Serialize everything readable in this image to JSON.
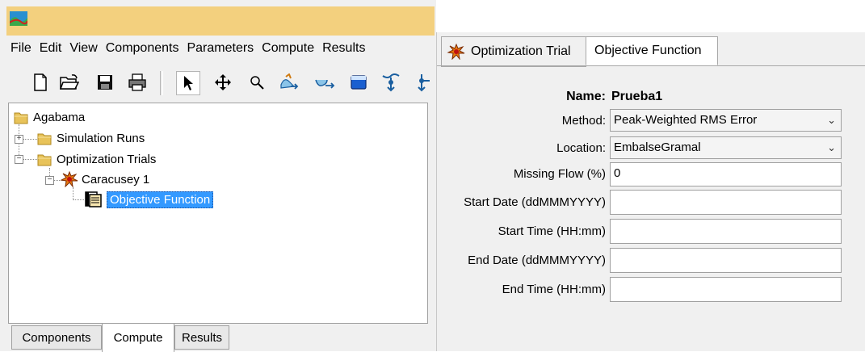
{
  "menu": {
    "items": [
      {
        "label": "File"
      },
      {
        "label": "Edit"
      },
      {
        "label": "View"
      },
      {
        "label": "Components"
      },
      {
        "label": "Parameters"
      },
      {
        "label": "Compute"
      },
      {
        "label": "Results"
      }
    ]
  },
  "toolbar": {
    "buttons": [
      "new-file-icon",
      "open-folder-icon",
      "save-icon",
      "print-icon",
      "pointer-tool-icon",
      "move-tool-icon",
      "zoom-tool-icon",
      "subbasin-tool-icon",
      "reach-tool-icon",
      "reservoir-tool-icon",
      "junction-tool-icon",
      "diversion-tool-icon"
    ]
  },
  "tree": {
    "root": "Agabama",
    "simulation_runs": "Simulation Runs",
    "optimization_trials": "Optimization Trials",
    "trial": "Caracusey 1",
    "objective_function": "Objective Function"
  },
  "bottom_tabs": {
    "components": "Components",
    "compute": "Compute",
    "results": "Results",
    "active": "Compute"
  },
  "editor": {
    "tabs": {
      "optimization_trial": "Optimization Trial",
      "objective_function": "Objective Function",
      "active": "Objective Function"
    },
    "fields": {
      "name_label": "Name:",
      "name_value": "Prueba1",
      "method_label": "Method:",
      "method_value": "Peak-Weighted RMS Error",
      "location_label": "Location:",
      "location_value": "EmbalseGramal",
      "missing_flow_label": "Missing Flow (%)",
      "missing_flow_value": "0",
      "start_date_label": "Start Date (ddMMMYYYY)",
      "start_date_value": "",
      "start_time_label": "Start Time (HH:mm)",
      "start_time_value": "",
      "end_date_label": "End Date (ddMMMYYYY)",
      "end_date_value": "",
      "end_time_label": "End Time (HH:mm)",
      "end_time_value": ""
    }
  },
  "colors": {
    "title_bar": "#f3d07e",
    "selection": "#3399ff",
    "folder": "#e8c35a"
  }
}
